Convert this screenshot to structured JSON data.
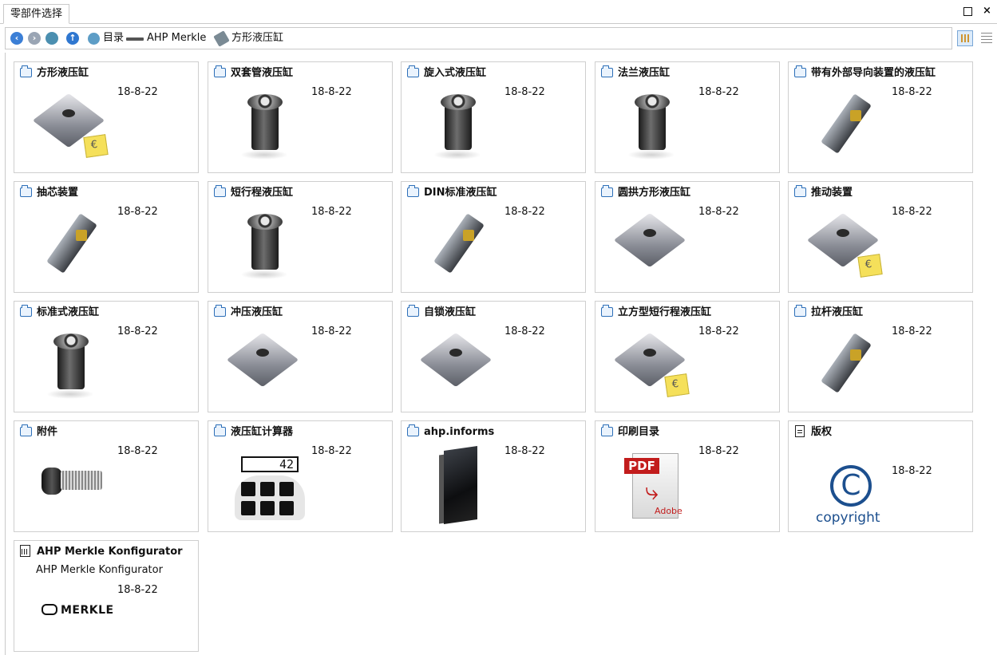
{
  "window": {
    "tab_label": "零部件选择",
    "close_label": "×"
  },
  "address": {
    "crumbs": [
      "目录",
      "AHP Merkle",
      "方形液压缸"
    ]
  },
  "tiles": [
    {
      "title": "方形液压缸",
      "date": "18-8-22",
      "icon": "folder-icon",
      "image": "square-cylinder"
    },
    {
      "title": "双套管液压缸",
      "date": "18-8-22",
      "icon": "folder-icon",
      "image": "double-tube-cylinder"
    },
    {
      "title": "旋入式液压缸",
      "date": "18-8-22",
      "icon": "folder-icon",
      "image": "screw-in-cylinder"
    },
    {
      "title": "法兰液压缸",
      "date": "18-8-22",
      "icon": "folder-icon",
      "image": "flange-cylinder"
    },
    {
      "title": "带有外部导向装置的液压缸",
      "date": "18-8-22",
      "icon": "folder-icon",
      "image": "guided-cylinder"
    },
    {
      "title": "抽芯装置",
      "date": "18-8-22",
      "icon": "folder-icon",
      "image": "core-pull"
    },
    {
      "title": "短行程液压缸",
      "date": "18-8-22",
      "icon": "folder-icon",
      "image": "short-stroke-cylinder"
    },
    {
      "title": "DIN标准液压缸",
      "date": "18-8-22",
      "icon": "folder-icon",
      "image": "din-cylinder"
    },
    {
      "title": "圆拱方形液压缸",
      "date": "18-8-22",
      "icon": "folder-icon",
      "image": "round-square-cylinder"
    },
    {
      "title": "推动装置",
      "date": "18-8-22",
      "icon": "folder-icon",
      "image": "push-unit"
    },
    {
      "title": "标准式液压缸",
      "date": "18-8-22",
      "icon": "folder-icon",
      "image": "standard-cylinder"
    },
    {
      "title": "冲压液压缸",
      "date": "18-8-22",
      "icon": "folder-icon",
      "image": "punch-cylinder"
    },
    {
      "title": "自锁液压缸",
      "date": "18-8-22",
      "icon": "folder-icon",
      "image": "self-lock-cylinder"
    },
    {
      "title": "立方型短行程液压缸",
      "date": "18-8-22",
      "icon": "folder-icon",
      "image": "cube-short-stroke"
    },
    {
      "title": "拉杆液压缸",
      "date": "18-8-22",
      "icon": "folder-icon",
      "image": "tie-rod-cylinder"
    },
    {
      "title": "附件",
      "date": "18-8-22",
      "icon": "folder-icon",
      "image": "accessory"
    },
    {
      "title": "液压缸计算器",
      "date": "18-8-22",
      "icon": "folder-icon",
      "image": "calculator",
      "display": "42"
    },
    {
      "title": "ahp.informs",
      "date": "18-8-22",
      "icon": "folder-icon",
      "image": "brochure"
    },
    {
      "title": "印刷目录",
      "date": "18-8-22",
      "icon": "folder-icon",
      "image": "pdf",
      "pdf_label": "PDF",
      "pdf_brand": "Adobe"
    },
    {
      "title": "版权",
      "date": "18-8-22",
      "icon": "document-icon",
      "image": "copyright",
      "copyright_word": "copyright"
    },
    {
      "title": "AHP Merkle Konfigurator",
      "desc": "AHP Merkle Konfigurator",
      "date": "18-8-22",
      "icon": "calculator-icon",
      "logo": "MERKLE"
    }
  ],
  "colors": {
    "folder": "#2d6fb8",
    "accent_blue": "#3b7fd6",
    "pdf_red": "#c21c1c"
  }
}
